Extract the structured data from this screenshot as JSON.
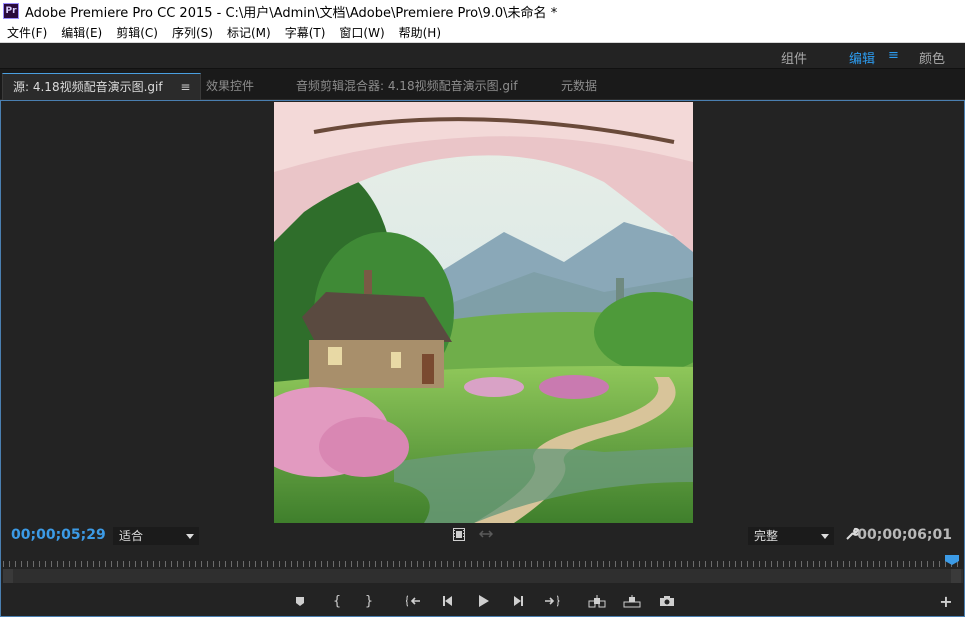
{
  "window": {
    "title": "Adobe Premiere Pro CC 2015 - C:\\用户\\Admin\\文档\\Adobe\\Premiere Pro\\9.0\\未命名 *",
    "app_icon_text": "Pr"
  },
  "menu": {
    "items": [
      "文件(F)",
      "编辑(E)",
      "剪辑(C)",
      "序列(S)",
      "标记(M)",
      "字幕(T)",
      "窗口(W)",
      "帮助(H)"
    ]
  },
  "workspaces": {
    "items": [
      {
        "label": "组件",
        "active": false
      },
      {
        "label": "编辑",
        "active": true
      },
      {
        "label": "颜色",
        "active": false
      }
    ],
    "menu_icon": "≡"
  },
  "tabs": [
    {
      "label": "源: 4.18视频配音演示图.gif",
      "active": true
    },
    {
      "label": "效果控件",
      "active": false
    },
    {
      "label": "音频剪辑混合器: 4.18视频配音演示图.gif",
      "active": false
    },
    {
      "label": "元数据",
      "active": false
    }
  ],
  "tab_menu_icon": "≡",
  "monitor": {
    "current_timecode": "00;00;05;29",
    "duration_timecode": "00;00;06;01",
    "zoom_select": "适合",
    "resolution_select": "完整",
    "accent_color": "#3c9be6",
    "playhead_progress": 0.98
  },
  "icons": {
    "film": "film-icon",
    "export_frame_small": "insert-clip-icon",
    "wrench": "wrench-icon",
    "add": "+"
  },
  "transport": [
    {
      "name": "add-marker-button",
      "icon": "marker-icon"
    },
    {
      "name": "mark-in-button",
      "icon": "{"
    },
    {
      "name": "mark-out-button",
      "icon": "}"
    },
    {
      "name": "go-to-in-button",
      "icon": "go-to-in-icon"
    },
    {
      "name": "step-back-button",
      "icon": "step-back-icon"
    },
    {
      "name": "play-button",
      "icon": "play-icon"
    },
    {
      "name": "step-forward-button",
      "icon": "step-forward-icon"
    },
    {
      "name": "go-to-out-button",
      "icon": "go-to-out-icon"
    },
    {
      "name": "insert-button",
      "icon": "insert-icon"
    },
    {
      "name": "overwrite-button",
      "icon": "overwrite-icon"
    },
    {
      "name": "export-frame-button",
      "icon": "camera-icon"
    }
  ]
}
